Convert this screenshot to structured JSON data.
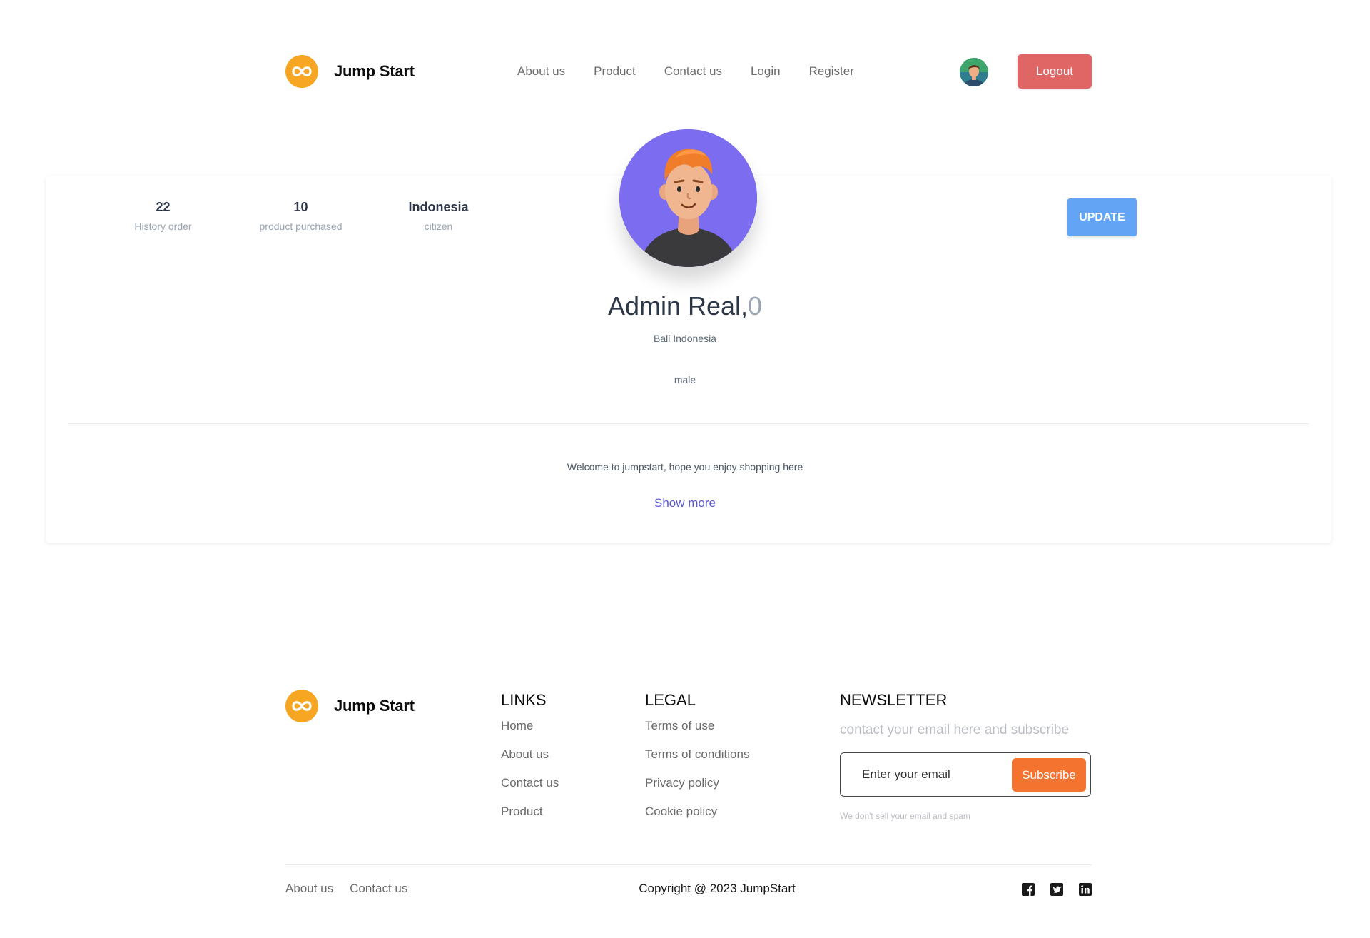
{
  "header": {
    "brand": "Jump Start",
    "nav": [
      "About us",
      "Product",
      "Contact us",
      "Login",
      "Register"
    ],
    "logout_label": "Logout"
  },
  "profile": {
    "stats": [
      {
        "value": "22",
        "label": "History order"
      },
      {
        "value": "10",
        "label": "product purchased"
      },
      {
        "value": "Indonesia",
        "label": "citizen"
      }
    ],
    "update_label": "UPDATE",
    "name": "Admin Real,",
    "age": "0",
    "location": "Bali Indonesia",
    "gender": "male",
    "welcome": "Welcome to jumpstart, hope you enjoy shopping here",
    "show_more": "Show more"
  },
  "footer": {
    "brand": "Jump Start",
    "links": {
      "title": "LINKS",
      "items": [
        "Home",
        "About us",
        "Contact us",
        "Product"
      ]
    },
    "legal": {
      "title": "LEGAL",
      "items": [
        "Terms of use",
        "Terms of conditions",
        "Privacy policy",
        "Cookie policy"
      ]
    },
    "newsletter": {
      "title": "NEWSLETTER",
      "description": "contact your email here and subscribe",
      "placeholder": "Enter your email",
      "button": "Subscribe",
      "note": "We don't sell your email and spam"
    },
    "bottom_links": [
      "About us",
      "Contact us"
    ],
    "copyright": "Copyright @ 2023 JumpStart",
    "socials": [
      "facebook-icon",
      "twitter-icon",
      "linkedin-icon"
    ]
  },
  "colors": {
    "logo": "#f6a623",
    "logout": "#e06666",
    "update": "#63a4f5",
    "avatar_bg": "#7b6cf0",
    "show_more": "#5a57d6",
    "subscribe": "#f4742f"
  }
}
